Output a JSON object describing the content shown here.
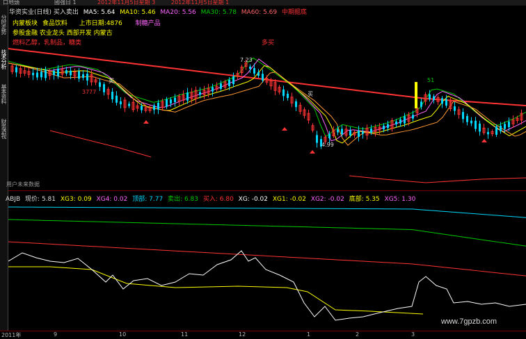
{
  "top_strip": {
    "left": "口地頭",
    "mid": "國強日 1",
    "date": "2012年11月5日星期 3",
    "date2": "2012年11月5日星期 1"
  },
  "sidebar": {
    "tabs": [
      "分时走势",
      "技术分析",
      "基本资料",
      "财务透视"
    ]
  },
  "main_header": {
    "stock": "华资实业(日线) 买入卖出",
    "ma5": "MA5: 5.64",
    "ma10": "MA10: 5.46",
    "ma20": "MA20: 5.56",
    "ma30": "MA30: 5.78",
    "ma60": "MA60: 5.69",
    "warn": "中期掘底",
    "marker_x": "×"
  },
  "info": {
    "line1a": "内蒙板块",
    "line1b": "食品饮料",
    "line1c": "上市日期:4876",
    "line1d": "制糖产品",
    "line2": "参股金融 农业龙头 西部开发 内蒙古",
    "line3": "燃料乙醇，乳制品，糖类",
    "line3b": "多买"
  },
  "chart_labels": {
    "high": "7.23",
    "low": "4.99",
    "buy1": "买",
    "buy2": "买",
    "label_3777": "3777",
    "label_51": "51",
    "label_sp": "用户未来数据"
  },
  "indicator_header": {
    "name": "ABJB",
    "xj": "现价: 5.81",
    "xg3": "XG3: 0.09",
    "xg4": "XG4: 0.02",
    "dingbu": "顶部: 7.77",
    "maichu": "卖出: 6.83",
    "mairu": "买入: 6.80",
    "xg": "XG: -0.02",
    "xg1": "XG1: -0.02",
    "xg2": "XG2: -0.02",
    "dibu": "底部: 5.35",
    "xg5": "XG5: 1.30"
  },
  "x_axis": {
    "labels": [
      "2011年",
      "9",
      "10",
      "11",
      "12",
      "1",
      "2",
      "3"
    ]
  },
  "watermark": "www.7gpzb.com",
  "colors": {
    "up": "#ff3333",
    "down": "#00d8ff",
    "ma5": "#ffffff",
    "ma10": "#ffff00",
    "ma20": "#ff66ff",
    "ma30": "#00cc00",
    "ma60": "#ff3333"
  }
}
